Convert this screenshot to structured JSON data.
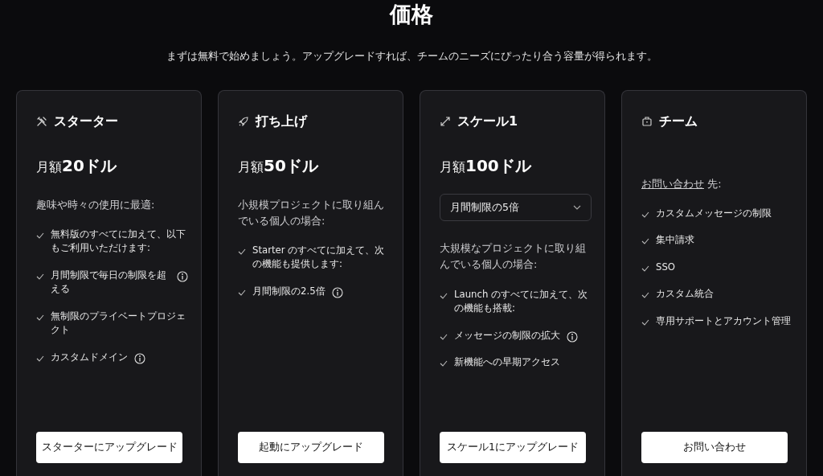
{
  "title": "価格",
  "subtitle": "まずは無料で始めましょう。アップグレードすれば、チームのニーズにぴったり合う容量が得られます。",
  "plans": [
    {
      "name": "スターター",
      "price_prefix": "月額",
      "price": "20ドル",
      "description": "趣味や時々の使用に最適:",
      "features": [
        {
          "text": "無料版のすべてに加えて、以下もご利用いただけます:",
          "info": false
        },
        {
          "text": "月間制限で毎日の制限を超える",
          "info": true
        },
        {
          "text": "無制限のプライベートプロジェクト",
          "info": false
        },
        {
          "text": "カスタムドメイン",
          "info": true
        }
      ],
      "button": "スターターにアップグレード"
    },
    {
      "name": "打ち上げ",
      "price_prefix": "月額",
      "price": "50ドル",
      "description": "小規模プロジェクトに取り組んでいる個人の場合:",
      "features": [
        {
          "text": "Starter のすべてに加えて、次の機能も提供します:",
          "info": false
        },
        {
          "text": "月間制限の2.5倍",
          "info": true
        }
      ],
      "button": "起動にアップグレード"
    },
    {
      "name": "スケール1",
      "price_prefix": "月額",
      "price": "100ドル",
      "select": "月間制限の5倍",
      "description": "大規模なプロジェクトに取り組んでいる個人の場合:",
      "features": [
        {
          "text": "Launch のすべてに加えて、次の機能も搭載:",
          "info": false
        },
        {
          "text": "メッセージの制限の拡大",
          "info": true
        },
        {
          "text": "新機能への早期アクセス",
          "info": false
        }
      ],
      "button": "スケール1にアップグレード"
    },
    {
      "name": "チーム",
      "contact_link": "お問い合わせ",
      "description": "先:",
      "features": [
        {
          "text": "カスタムメッセージの制限",
          "info": false
        },
        {
          "text": "集中請求",
          "info": false
        },
        {
          "text": "SSO",
          "info": false
        },
        {
          "text": "カスタム統合",
          "info": false
        },
        {
          "text": "専用サポートとアカウント管理",
          "info": false
        }
      ],
      "button": "お問い合わせ"
    }
  ]
}
